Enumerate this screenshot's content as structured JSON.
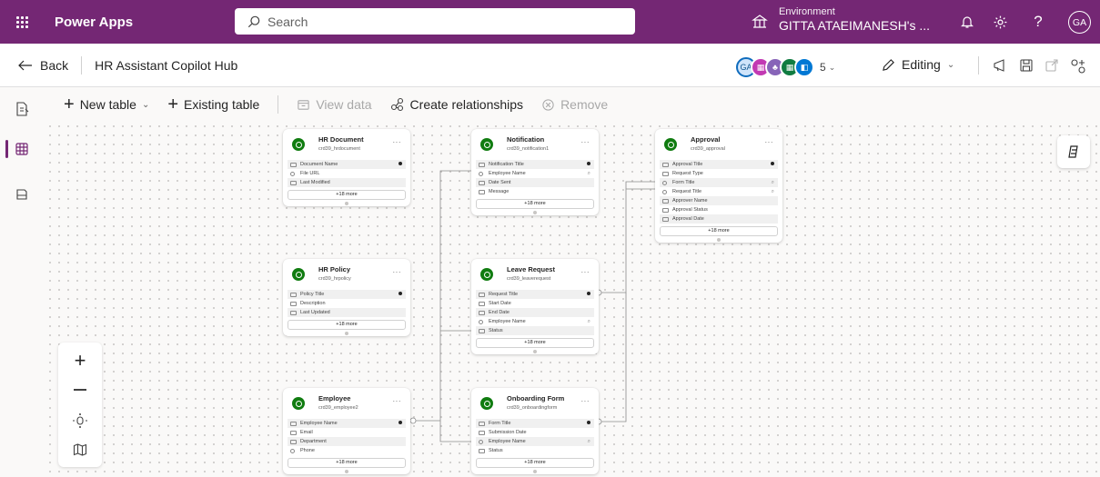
{
  "header": {
    "app_name": "Power Apps",
    "search_placeholder": "Search",
    "environment_label": "Environment",
    "environment_name": "GITTA ATAEIMANESH's ...",
    "user_initials": "GA"
  },
  "command_bar": {
    "back_label": "Back",
    "title": "HR Assistant Copilot Hub",
    "presence_initials": "GA",
    "presence_count": "5",
    "mode_label": "Editing"
  },
  "toolbar": {
    "new_table": "New table",
    "existing_table": "Existing table",
    "view_data": "View data",
    "create_relationships": "Create relationships",
    "remove": "Remove"
  },
  "tables": [
    {
      "title": "HR Document",
      "logical": "crd39_hrdocument",
      "more": "+18 more",
      "columns": [
        {
          "name": "Document Name",
          "icon": "text"
        },
        {
          "name": "File URL",
          "icon": "link"
        },
        {
          "name": "Last Modified",
          "icon": "date"
        }
      ]
    },
    {
      "title": "Notification",
      "logical": "crd39_notification1",
      "more": "+18 more",
      "columns": [
        {
          "name": "Notification Title",
          "icon": "text"
        },
        {
          "name": "Employee Name",
          "icon": "lookup"
        },
        {
          "name": "Date Sent",
          "icon": "date"
        },
        {
          "name": "Message",
          "icon": "text"
        }
      ]
    },
    {
      "title": "Approval",
      "logical": "crd39_approval",
      "more": "+18 more",
      "columns": [
        {
          "name": "Approval Title",
          "icon": "text"
        },
        {
          "name": "Request Type",
          "icon": "choice"
        },
        {
          "name": "Form Title",
          "icon": "lookup"
        },
        {
          "name": "Request Title",
          "icon": "lookup"
        },
        {
          "name": "Approver Name",
          "icon": "text"
        },
        {
          "name": "Approval Status",
          "icon": "choice"
        },
        {
          "name": "Approval Date",
          "icon": "date"
        }
      ]
    },
    {
      "title": "HR Policy",
      "logical": "crd39_hrpolicy",
      "more": "+18 more",
      "columns": [
        {
          "name": "Policy Title",
          "icon": "text"
        },
        {
          "name": "Description",
          "icon": "text"
        },
        {
          "name": "Last Updated",
          "icon": "date"
        }
      ]
    },
    {
      "title": "Leave Request",
      "logical": "crd39_leaverequest",
      "more": "+18 more",
      "columns": [
        {
          "name": "Request Title",
          "icon": "text"
        },
        {
          "name": "Start Date",
          "icon": "date"
        },
        {
          "name": "End Date",
          "icon": "date"
        },
        {
          "name": "Employee Name",
          "icon": "lookup"
        },
        {
          "name": "Status",
          "icon": "choice"
        }
      ]
    },
    {
      "title": "Employee",
      "logical": "crd39_employee2",
      "more": "+18 more",
      "columns": [
        {
          "name": "Employee Name",
          "icon": "text"
        },
        {
          "name": "Email",
          "icon": "text"
        },
        {
          "name": "Department",
          "icon": "text"
        },
        {
          "name": "Phone",
          "icon": "phone"
        }
      ]
    },
    {
      "title": "Onboarding Form",
      "logical": "crd39_onboardingform",
      "more": "+18 more",
      "columns": [
        {
          "name": "Form Title",
          "icon": "text"
        },
        {
          "name": "Submission Date",
          "icon": "date"
        },
        {
          "name": "Employee Name",
          "icon": "lookup"
        },
        {
          "name": "Status",
          "icon": "choice"
        }
      ]
    }
  ],
  "colors": {
    "brand": "#742774",
    "table_icon": "#107c10"
  }
}
